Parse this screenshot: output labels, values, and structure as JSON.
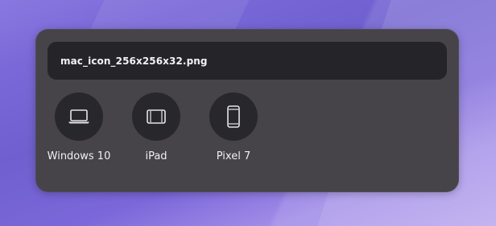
{
  "file": {
    "name": "mac_icon_256x256x32.png"
  },
  "devices": [
    {
      "label": "Windows 10",
      "icon": "laptop-icon"
    },
    {
      "label": "iPad",
      "icon": "tablet-icon"
    },
    {
      "label": "Pixel 7",
      "icon": "phone-icon"
    }
  ],
  "colors": {
    "panel": "#464349",
    "field": "#252428",
    "device_circle": "#28272b",
    "text": "#f0eff2"
  }
}
